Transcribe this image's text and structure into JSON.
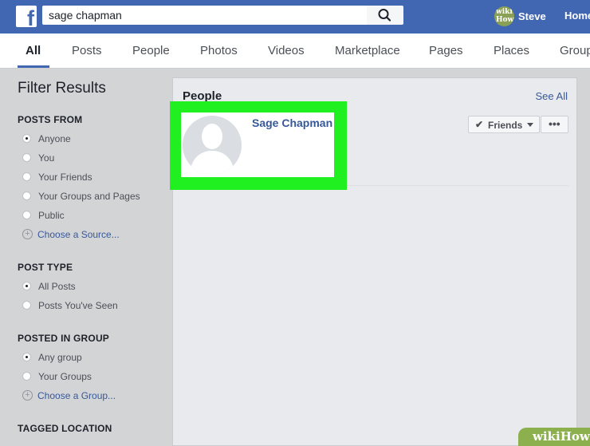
{
  "topbar": {
    "logo_letter": "f",
    "search_value": "sage chapman",
    "user_name": "Steve",
    "home_label": "Home"
  },
  "tabs": [
    "All",
    "Posts",
    "People",
    "Photos",
    "Videos",
    "Marketplace",
    "Pages",
    "Places",
    "Groups"
  ],
  "filter": {
    "title": "Filter Results",
    "posts_from": {
      "title": "POSTS FROM",
      "options": [
        "Anyone",
        "You",
        "Your Friends",
        "Your Groups and Pages",
        "Public"
      ],
      "selected": "Anyone",
      "add_link": "Choose a Source..."
    },
    "post_type": {
      "title": "POST TYPE",
      "options": [
        "All Posts",
        "Posts You've Seen"
      ],
      "selected": "All Posts"
    },
    "posted_in_group": {
      "title": "POSTED IN GROUP",
      "options": [
        "Any group",
        "Your Groups"
      ],
      "selected": "Any group",
      "add_link": "Choose a Group..."
    },
    "tagged_location": {
      "title": "TAGGED LOCATION"
    }
  },
  "people_panel": {
    "title": "People",
    "see_all": "See All",
    "result": {
      "name": "Sage Chapman",
      "friends_button": "Friends",
      "more_button": "•••"
    }
  },
  "highlight_color": "#20f020",
  "watermark": "wikiHow"
}
